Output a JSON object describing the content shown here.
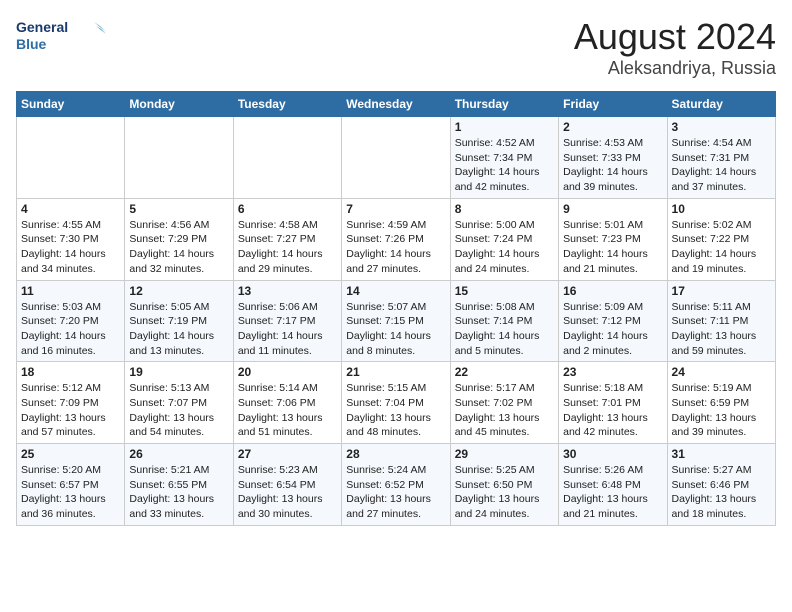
{
  "header": {
    "logo_line1": "General",
    "logo_line2": "Blue",
    "month": "August 2024",
    "location": "Aleksandriya, Russia"
  },
  "days_of_week": [
    "Sunday",
    "Monday",
    "Tuesday",
    "Wednesday",
    "Thursday",
    "Friday",
    "Saturday"
  ],
  "weeks": [
    [
      {
        "day": "",
        "info": ""
      },
      {
        "day": "",
        "info": ""
      },
      {
        "day": "",
        "info": ""
      },
      {
        "day": "",
        "info": ""
      },
      {
        "day": "1",
        "info": "Sunrise: 4:52 AM\nSunset: 7:34 PM\nDaylight: 14 hours\nand 42 minutes."
      },
      {
        "day": "2",
        "info": "Sunrise: 4:53 AM\nSunset: 7:33 PM\nDaylight: 14 hours\nand 39 minutes."
      },
      {
        "day": "3",
        "info": "Sunrise: 4:54 AM\nSunset: 7:31 PM\nDaylight: 14 hours\nand 37 minutes."
      }
    ],
    [
      {
        "day": "4",
        "info": "Sunrise: 4:55 AM\nSunset: 7:30 PM\nDaylight: 14 hours\nand 34 minutes."
      },
      {
        "day": "5",
        "info": "Sunrise: 4:56 AM\nSunset: 7:29 PM\nDaylight: 14 hours\nand 32 minutes."
      },
      {
        "day": "6",
        "info": "Sunrise: 4:58 AM\nSunset: 7:27 PM\nDaylight: 14 hours\nand 29 minutes."
      },
      {
        "day": "7",
        "info": "Sunrise: 4:59 AM\nSunset: 7:26 PM\nDaylight: 14 hours\nand 27 minutes."
      },
      {
        "day": "8",
        "info": "Sunrise: 5:00 AM\nSunset: 7:24 PM\nDaylight: 14 hours\nand 24 minutes."
      },
      {
        "day": "9",
        "info": "Sunrise: 5:01 AM\nSunset: 7:23 PM\nDaylight: 14 hours\nand 21 minutes."
      },
      {
        "day": "10",
        "info": "Sunrise: 5:02 AM\nSunset: 7:22 PM\nDaylight: 14 hours\nand 19 minutes."
      }
    ],
    [
      {
        "day": "11",
        "info": "Sunrise: 5:03 AM\nSunset: 7:20 PM\nDaylight: 14 hours\nand 16 minutes."
      },
      {
        "day": "12",
        "info": "Sunrise: 5:05 AM\nSunset: 7:19 PM\nDaylight: 14 hours\nand 13 minutes."
      },
      {
        "day": "13",
        "info": "Sunrise: 5:06 AM\nSunset: 7:17 PM\nDaylight: 14 hours\nand 11 minutes."
      },
      {
        "day": "14",
        "info": "Sunrise: 5:07 AM\nSunset: 7:15 PM\nDaylight: 14 hours\nand 8 minutes."
      },
      {
        "day": "15",
        "info": "Sunrise: 5:08 AM\nSunset: 7:14 PM\nDaylight: 14 hours\nand 5 minutes."
      },
      {
        "day": "16",
        "info": "Sunrise: 5:09 AM\nSunset: 7:12 PM\nDaylight: 14 hours\nand 2 minutes."
      },
      {
        "day": "17",
        "info": "Sunrise: 5:11 AM\nSunset: 7:11 PM\nDaylight: 13 hours\nand 59 minutes."
      }
    ],
    [
      {
        "day": "18",
        "info": "Sunrise: 5:12 AM\nSunset: 7:09 PM\nDaylight: 13 hours\nand 57 minutes."
      },
      {
        "day": "19",
        "info": "Sunrise: 5:13 AM\nSunset: 7:07 PM\nDaylight: 13 hours\nand 54 minutes."
      },
      {
        "day": "20",
        "info": "Sunrise: 5:14 AM\nSunset: 7:06 PM\nDaylight: 13 hours\nand 51 minutes."
      },
      {
        "day": "21",
        "info": "Sunrise: 5:15 AM\nSunset: 7:04 PM\nDaylight: 13 hours\nand 48 minutes."
      },
      {
        "day": "22",
        "info": "Sunrise: 5:17 AM\nSunset: 7:02 PM\nDaylight: 13 hours\nand 45 minutes."
      },
      {
        "day": "23",
        "info": "Sunrise: 5:18 AM\nSunset: 7:01 PM\nDaylight: 13 hours\nand 42 minutes."
      },
      {
        "day": "24",
        "info": "Sunrise: 5:19 AM\nSunset: 6:59 PM\nDaylight: 13 hours\nand 39 minutes."
      }
    ],
    [
      {
        "day": "25",
        "info": "Sunrise: 5:20 AM\nSunset: 6:57 PM\nDaylight: 13 hours\nand 36 minutes."
      },
      {
        "day": "26",
        "info": "Sunrise: 5:21 AM\nSunset: 6:55 PM\nDaylight: 13 hours\nand 33 minutes."
      },
      {
        "day": "27",
        "info": "Sunrise: 5:23 AM\nSunset: 6:54 PM\nDaylight: 13 hours\nand 30 minutes."
      },
      {
        "day": "28",
        "info": "Sunrise: 5:24 AM\nSunset: 6:52 PM\nDaylight: 13 hours\nand 27 minutes."
      },
      {
        "day": "29",
        "info": "Sunrise: 5:25 AM\nSunset: 6:50 PM\nDaylight: 13 hours\nand 24 minutes."
      },
      {
        "day": "30",
        "info": "Sunrise: 5:26 AM\nSunset: 6:48 PM\nDaylight: 13 hours\nand 21 minutes."
      },
      {
        "day": "31",
        "info": "Sunrise: 5:27 AM\nSunset: 6:46 PM\nDaylight: 13 hours\nand 18 minutes."
      }
    ]
  ]
}
